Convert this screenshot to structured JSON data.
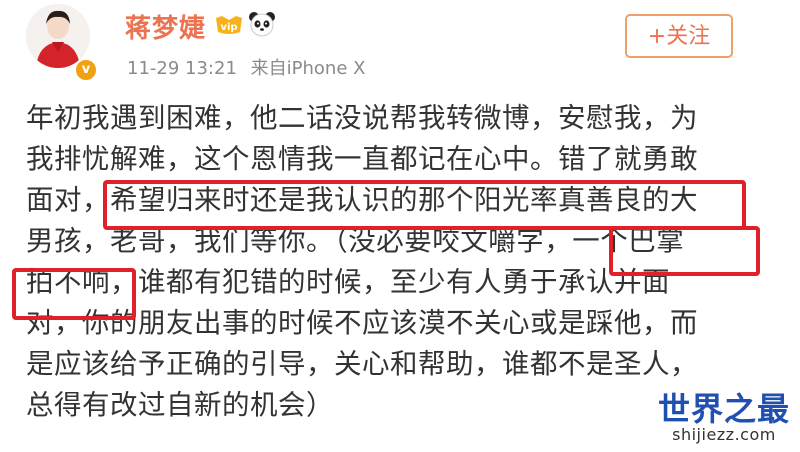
{
  "header": {
    "username": "蒋梦婕",
    "timestamp": "11-29 13:21",
    "source": "来自iPhone X",
    "follow_label": "+关注",
    "badges": [
      "vip-badge-icon",
      "panda-icon"
    ]
  },
  "post": {
    "lines": [
      "年初我遇到困难，他二话没说帮我转微博，安慰我，为",
      "我排忧解难，这个恩情我一直都记在心中。错了就勇敢",
      "面对，希望归来时还是我认识的那个阳光率真善良的大",
      "男孩，老哥，我们等你。（没必要咬文嚼字，一个巴掌",
      "拍不响，谁都有犯错的时候，至少有人勇于承认并面",
      "对，你的朋友出事的时候不应该漠不关心或是踩他，而",
      "是应该给予正确的引导，关心和帮助，谁都不是圣人，",
      "总得有改过自新的机会）"
    ]
  },
  "watermark": {
    "main": "世界之最",
    "sub": "shijiezz.com"
  },
  "colors": {
    "username": "#eb7350",
    "highlight": "#e0212a",
    "follow_border": "#f0a06a",
    "watermark": "#1f4fb0"
  }
}
